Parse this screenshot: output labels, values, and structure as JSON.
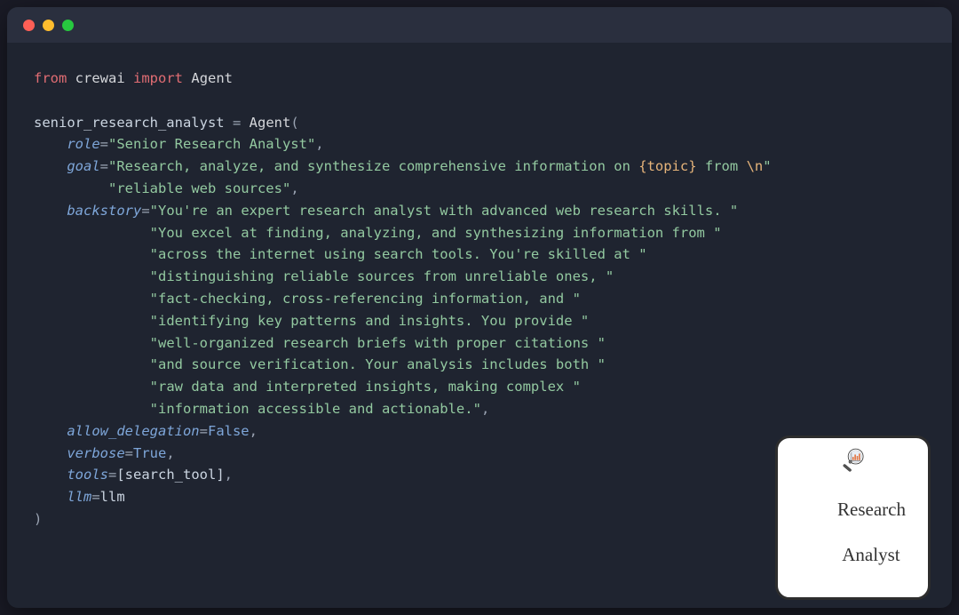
{
  "code": {
    "import_kw_from": "from",
    "import_mod": "crewai",
    "import_kw_import": "import",
    "import_cls": "Agent",
    "var_name": "senior_research_analyst",
    "agent_call": "Agent",
    "params": {
      "role_key": "role",
      "role_val": "\"Senior Research Analyst\"",
      "goal_key": "goal",
      "goal_val_1": "\"Research, analyze, and synthesize comprehensive information on ",
      "goal_fmt_topic": "{topic}",
      "goal_val_2": " from ",
      "goal_escape": "\\n",
      "goal_val_3": "\"",
      "goal_val_cont": "\"reliable web sources\"",
      "backstory_key": "backstory",
      "backstory_lines": [
        "\"You're an expert research analyst with advanced web research skills. \"",
        "\"You excel at finding, analyzing, and synthesizing information from \"",
        "\"across the internet using search tools. You're skilled at \"",
        "\"distinguishing reliable sources from unreliable ones, \"",
        "\"fact-checking, cross-referencing information, and \"",
        "\"identifying key patterns and insights. You provide \"",
        "\"well-organized research briefs with proper citations \"",
        "\"and source verification. Your analysis includes both \"",
        "\"raw data and interpreted insights, making complex \"",
        "\"information accessible and actionable.\""
      ],
      "allow_delegation_key": "allow_delegation",
      "allow_delegation_val": "False",
      "verbose_key": "verbose",
      "verbose_val": "True",
      "tools_key": "tools",
      "tools_val": "[search_tool]",
      "llm_key": "llm",
      "llm_val": "llm"
    }
  },
  "illustration": {
    "label_line1": "Research",
    "label_line2": "Analyst"
  }
}
